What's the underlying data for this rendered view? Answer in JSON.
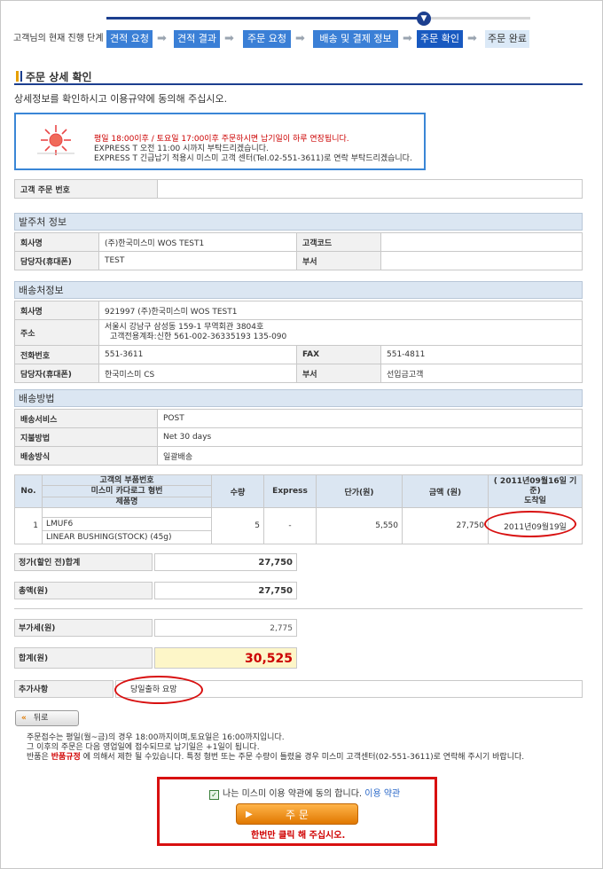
{
  "progress": {
    "label": "고객님의 현재 진행 단계",
    "steps": [
      "견적 요청",
      "견적 결과",
      "주문 요청",
      "배송 및 결제 정보",
      "주문 확인",
      "주문 완료"
    ],
    "marker_icon": "down-arrow-icon"
  },
  "page": {
    "title": "주문 상세 확인",
    "desc": "상세정보를 확인하시고 이용규약에 동의해 주십시오."
  },
  "notice": {
    "icon": "sun-icon",
    "line1": "평일 18:00이후 / 토요일 17:00이후 주문하시면 납기일이 하루 연장됩니다.",
    "line2": "EXPRESS T 오전 11:00 시까지 부탁드리겠습니다.",
    "line3": "EXPRESS T 긴급납기 적용시 미스미 고객 센터(Tel.02-551-3611)로 연락 부탁드리겠습니다.",
    "accent_color": "#cc0000"
  },
  "customer_order": {
    "label": "고객 주문 번호",
    "value": ""
  },
  "orderer": {
    "title": "발주처 정보",
    "company_label": "회사명",
    "company": "(주)한국미스미 WOS TEST1",
    "code_label": "고객코드",
    "code": "",
    "person_label": "담당자(휴대폰)",
    "person": "TEST",
    "dept_label": "부서",
    "dept": ""
  },
  "shipping": {
    "title": "배송처정보",
    "company_label": "회사명",
    "company": "921997 (주)한국미스미 WOS TEST1",
    "address_label": "주소",
    "address1": "서울시 강남구 삼성동 159-1 무역회관 3804호",
    "address2": "고객전용계좌:신한 561-002-36335193 135-090",
    "phone_label": "전화번호",
    "phone": "551-3611",
    "fax_label": "FAX",
    "fax": "551-4811",
    "person_label": "담당자(휴대폰)",
    "person": "한국미스미 CS",
    "dept_label": "부서",
    "dept": "선입금고객"
  },
  "method": {
    "title": "배송방법",
    "service_label": "배송서비스",
    "service": "POST",
    "payment_label": "지불방법",
    "payment": "Net 30 days",
    "type_label": "배송방식",
    "type": "일괄배송"
  },
  "items": {
    "headers": {
      "no": "No.",
      "part1": "고객의 부품번호",
      "part2": "미스미 카다로그 형번",
      "part3": "제품명",
      "qty": "수량",
      "express": "Express",
      "unit": "단가(원)",
      "amount": "금액 (원)",
      "date1": "( 2011년09월16일 기준)",
      "date2": "도착일"
    },
    "rows": [
      {
        "no": "1",
        "customer_part": "",
        "catalog": "LMUF6",
        "name": "LINEAR BUSHING(STOCK) (45g)",
        "qty": "5",
        "express": "-",
        "unit": "5,550",
        "amount": "27,750",
        "arrival": "2011년09월19일"
      }
    ]
  },
  "totals": {
    "list_label": "정가(할인 전)합계",
    "list": "27,750",
    "gross_label": "총액(원)",
    "gross": "27,750",
    "vat_label": "부가세(원)",
    "vat": "2,775",
    "sum_label": "합계(원)",
    "sum": "30,525",
    "sum_color": "#cc0000"
  },
  "extra": {
    "label": "추가사항",
    "value": "당일출하 요망"
  },
  "back_label": "뒤로",
  "notes": {
    "line1": "주문접수는 평일(월~금)의 경우 18:00까지이며,토요일은 16:00까지입니다.",
    "line2": "그 이후의 주문은 다음 영업일에 접수되므로 납기일은 +1일이 됩니다.",
    "line3a": "반품은 ",
    "line3b": "반품규정",
    "line3c": " 에 의해서 제한 될 수있습니다. 특정 형번 또는 주문 수량이 틀렸을 경우 미스미 고객센터(02-551-3611)로 연락해 주시기 바랍니다."
  },
  "agree": {
    "text": "나는 미스미 이용 약관에 동의 합니다.",
    "link": "이용 약관",
    "checked": true,
    "order_button": "주 문",
    "once": "한번만 클릭 해 주십시오."
  }
}
